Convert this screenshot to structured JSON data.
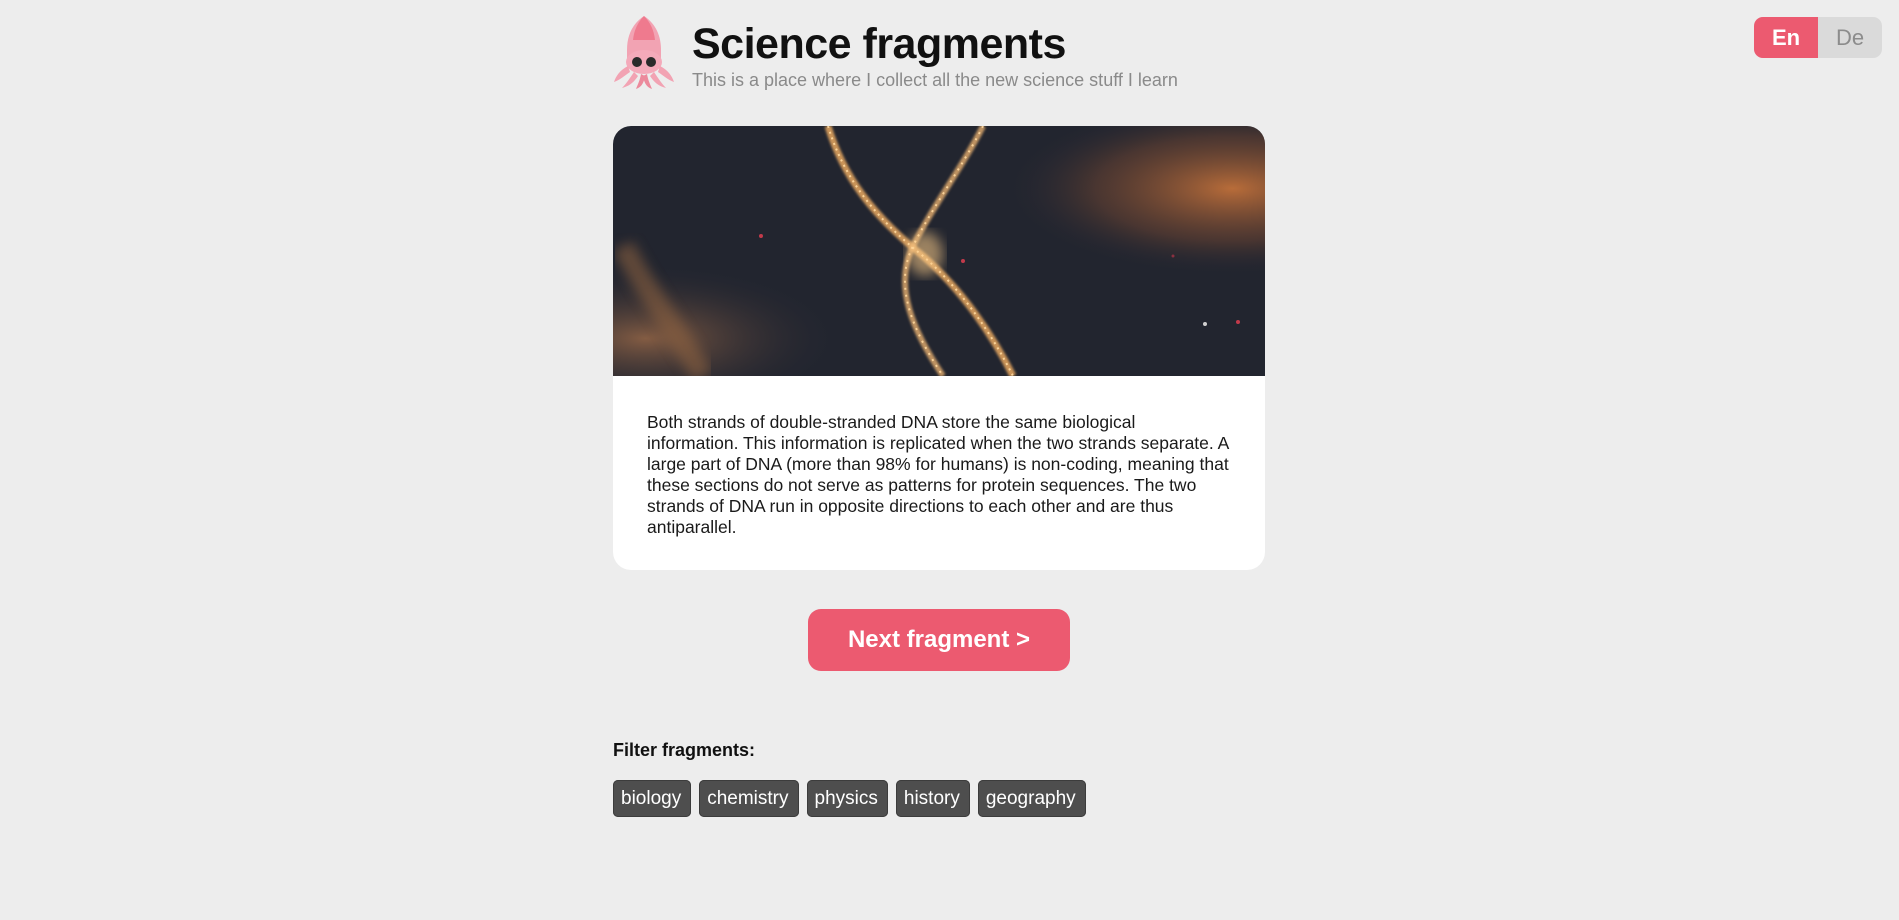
{
  "header": {
    "title": "Science fragments",
    "subtitle": "This is a place where I collect all the new science stuff I learn",
    "logo_icon": "squid-icon"
  },
  "language": {
    "options": [
      {
        "label": "En",
        "active": true
      },
      {
        "label": "De",
        "active": false
      }
    ]
  },
  "fragment": {
    "image_icon": "dna-helix-image",
    "text": "Both strands of double-stranded DNA store the same biological information. This information is replicated when the two strands separate. A large part of DNA (more than 98% for humans) is non-coding, meaning that these sections do not serve as patterns for protein sequences. The two strands of DNA run in opposite directions to each other and are thus antiparallel."
  },
  "next_button": {
    "label": "Next fragment >"
  },
  "filters": {
    "label": "Filter fragments:",
    "tags": [
      "biology",
      "chemistry",
      "physics",
      "history",
      "geography"
    ]
  },
  "colors": {
    "accent": "#ec5a70",
    "background": "#ededed",
    "tag_bg": "#4e4e4e"
  }
}
